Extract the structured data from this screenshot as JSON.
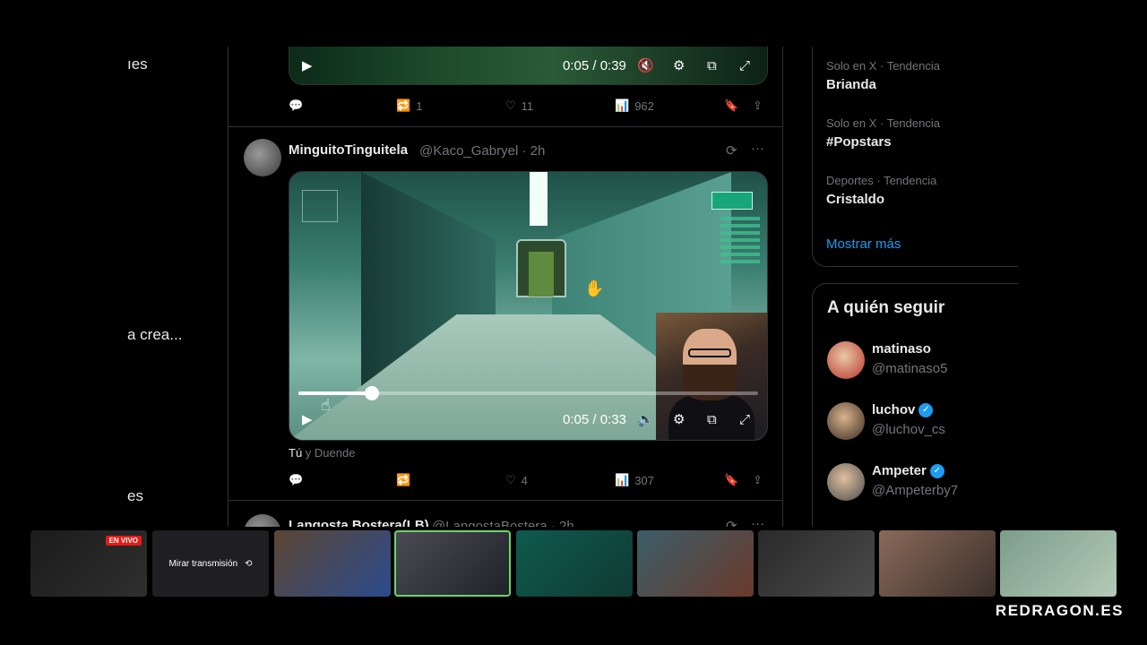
{
  "left_fragments": [
    "ıes",
    "a crea...",
    "es"
  ],
  "top_post": {
    "time": "0:05 / 0:39",
    "replies": "",
    "reposts": "1",
    "likes": "11",
    "views": "962"
  },
  "post": {
    "display_name": "MinguitoTinguitela",
    "handle": "@Kaco_Gabryel · 2h",
    "video_time": "0:05 / 0:33",
    "video_progress_fraction": 0.16,
    "liked_by_you": "Tú",
    "liked_by_rest": " y Duende",
    "replies": "",
    "reposts": "",
    "likes": "4",
    "views": "307"
  },
  "next_post": {
    "display_name": "Langosta Bostera(LB)",
    "handle": "@LangostaBostera · 2h"
  },
  "trends": [
    {
      "meta": "Solo en X · Tendencia",
      "name": "Brianda"
    },
    {
      "meta": "Solo en X · Tendencia",
      "name": "#Popstars"
    },
    {
      "meta": "Deportes · Tendencia",
      "name": "Cristaldo"
    }
  ],
  "show_more": "Mostrar más",
  "who_to_follow": {
    "title": "A quién seguir",
    "accounts": [
      {
        "name": "matinaso",
        "handle": "@matinaso5",
        "verified": false
      },
      {
        "name": "luchov",
        "handle": "@luchov_cs",
        "verified": true
      },
      {
        "name": "Ampeter",
        "handle": "@Ampeterby7",
        "verified": true
      }
    ]
  },
  "stream_strip": {
    "live_badge": "EN VIVO",
    "watch_label": "Mirar transmisión",
    "brand": "REDRAGON.ES"
  },
  "colors": {
    "background": "#000000",
    "border": "#2f3336",
    "muted": "#71767b",
    "accent": "#1d9bf0",
    "live": "#e91916"
  }
}
